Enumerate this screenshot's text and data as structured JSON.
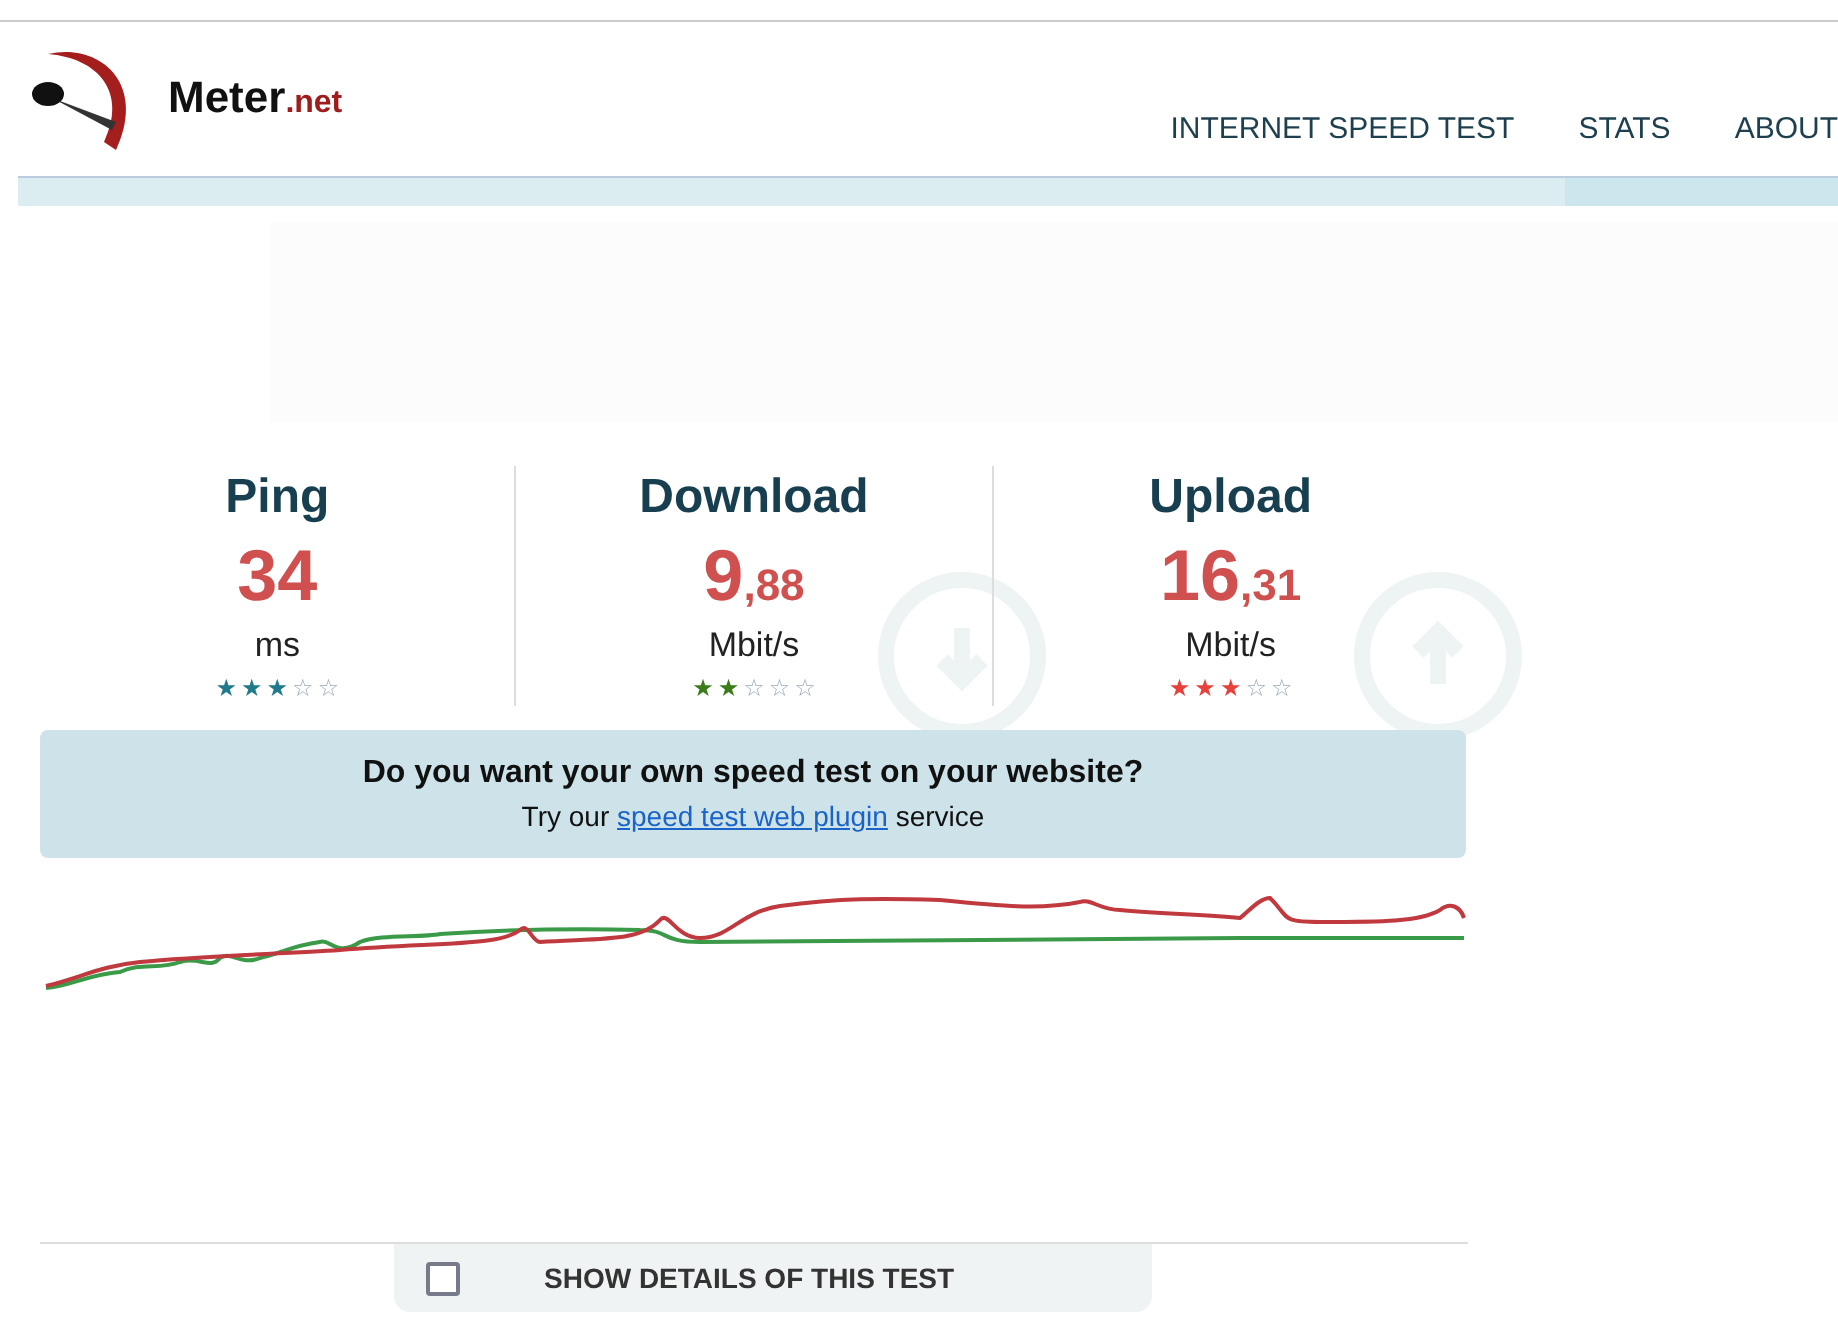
{
  "logo": {
    "name": "Meter",
    "suffix": ".net"
  },
  "nav": [
    {
      "label": "INTERNET SPEED TEST"
    },
    {
      "label": "STATS"
    },
    {
      "label": "ABOUT"
    }
  ],
  "results": [
    {
      "title": "Ping",
      "whole": "34",
      "unit": "ms",
      "stars": 3,
      "color": "#1f7a8c",
      "kind": "plain"
    },
    {
      "title": "Download",
      "whole": "9",
      "fraction": ",88",
      "unit": "Mbit/s",
      "stars": 2,
      "color": "#3a7d1a",
      "kind": "download"
    },
    {
      "title": "Upload",
      "whole": "16",
      "fraction": ",31",
      "unit": "Mbit/s",
      "stars": 3,
      "color": "#e8413c",
      "kind": "upload"
    }
  ],
  "banner": {
    "heading": "Do you want your own speed test on your website?",
    "before": "Try our",
    "link": "speed test web plugin",
    "after": "service"
  },
  "details": {
    "label": "SHOW DETAILS OF THIS TEST",
    "checked": false
  }
}
